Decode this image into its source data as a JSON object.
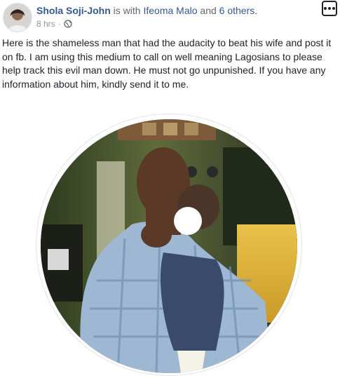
{
  "post": {
    "author": "Shola Soji-John",
    "with_text": "is with",
    "tagged_person": "Ifeoma Malo",
    "and_text": "and",
    "others_link": "6 others.",
    "timestamp": "8 hrs",
    "separator": "·",
    "audience_icon": "globe-icon",
    "more_icon": "ellipsis-icon",
    "body": "Here is the shameless man that had the audacity to beat his wife and post it on fb. I am using this medium to call on well meaning Lagosians to please help track this evil man down. He must not go unpunished. If you have any information about him, kindly send it to me."
  },
  "colors": {
    "link": "#365899",
    "text": "#1d2129",
    "meta": "#90949c"
  }
}
